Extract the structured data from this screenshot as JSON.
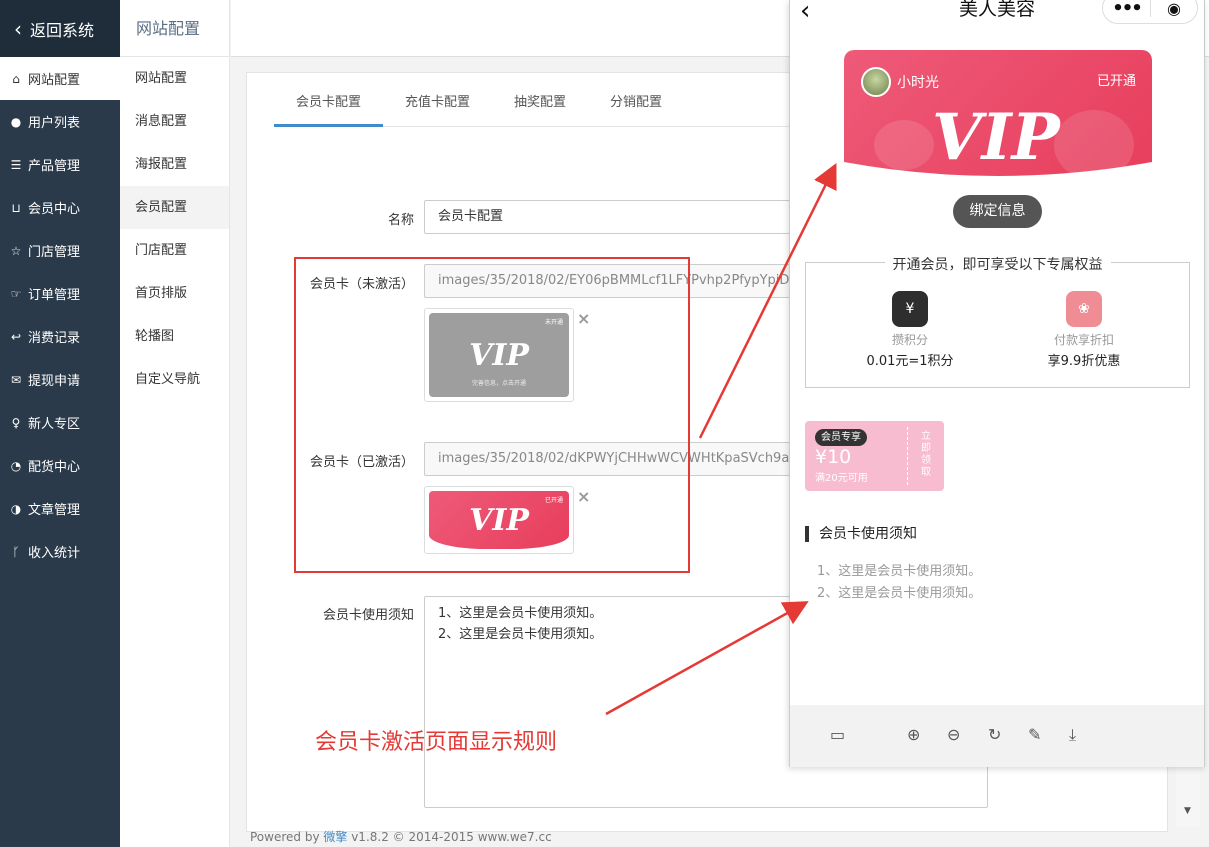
{
  "left_nav": {
    "back_label": "返回系统",
    "items": [
      {
        "label": "网站配置",
        "icon": "home-icon"
      },
      {
        "label": "用户列表",
        "icon": "user-icon"
      },
      {
        "label": "产品管理",
        "icon": "list-icon"
      },
      {
        "label": "会员中心",
        "icon": "cart-icon"
      },
      {
        "label": "门店管理",
        "icon": "star-icon"
      },
      {
        "label": "订单管理",
        "icon": "thumb-icon"
      },
      {
        "label": "消费记录",
        "icon": "reply-icon"
      },
      {
        "label": "提现申请",
        "icon": "chat-icon"
      },
      {
        "label": "新人专区",
        "icon": "pin-icon"
      },
      {
        "label": "配货中心",
        "icon": "pie-icon"
      },
      {
        "label": "文章管理",
        "icon": "contrast-icon"
      },
      {
        "label": "收入统计",
        "icon": "branch-icon"
      }
    ]
  },
  "sub_nav": {
    "title": "网站配置",
    "items": [
      "网站配置",
      "消息配置",
      "海报配置",
      "会员配置",
      "门店配置",
      "首页排版",
      "轮播图",
      "自定义导航"
    ]
  },
  "tabs": [
    "会员卡配置",
    "充值卡配置",
    "抽奖配置",
    "分销配置"
  ],
  "form": {
    "name_label": "名称",
    "name_value": "会员卡配置",
    "inactive_label": "会员卡（未激活）",
    "inactive_path": "images/35/2018/02/EY06pBMMLcf1LFYPvhp2PfypYpiDtF.png",
    "active_label": "会员卡（已激活）",
    "active_path": "images/35/2018/02/dKPWYjCHHwWCVWHtKpaSVch9aAk3Vh.png",
    "thumb_inactive": {
      "word": "VIP",
      "badge": "未开通",
      "sub": "完善信息，点击开通"
    },
    "thumb_active": {
      "word": "VIP",
      "badge": "已开通"
    },
    "remove_glyph": "×",
    "notice_label": "会员卡使用须知",
    "notice_lines": [
      "1、这里是会员卡使用须知。",
      "2、这里是会员卡使用须知。"
    ]
  },
  "annotation": "会员卡激活页面显示规则",
  "footer": {
    "prefix": "Powered by ",
    "brand": "微擎",
    "suffix": " v1.8.2 © 2014-2015 www.we7.cc"
  },
  "phone": {
    "title": "美人美容",
    "card": {
      "user_name": "小时光",
      "status": "已开通",
      "word": "VIP"
    },
    "bind_button": "绑定信息",
    "benefits_title": "开通会员，即可享受以下专属权益",
    "benefits": [
      {
        "name": "攒积分",
        "value": "0.01元=1积分",
        "icon": "wallet-icon"
      },
      {
        "name": "付款享折扣",
        "value": "享9.9折优惠",
        "icon": "discount-icon"
      }
    ],
    "coupon": {
      "tag": "会员专享",
      "amount": "¥10",
      "condition": "满20元可用",
      "action": "立即领取"
    },
    "notice_heading": "会员卡使用须知",
    "notice_lines": [
      "1、这里是会员卡使用须知。",
      "2、这里是会员卡使用须知。"
    ]
  },
  "colors": {
    "nav_bg": "#2b3a4a",
    "accent": "#428bca",
    "card_pink": "#e73e5c",
    "annotation_red": "#e53935",
    "coupon_pink": "#f7bcd0"
  }
}
